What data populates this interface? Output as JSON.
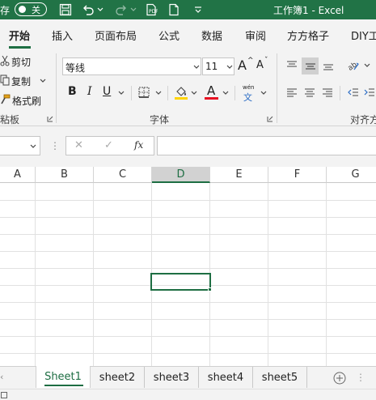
{
  "titlebar": {
    "autosave_label": "存",
    "toggle_label": "关",
    "title": "工作簿1 - Excel"
  },
  "tabs": [
    "开始",
    "插入",
    "页面布局",
    "公式",
    "数据",
    "审阅",
    "方方格子",
    "DIY工"
  ],
  "ribbon": {
    "clipboard": {
      "cut": "剪切",
      "copy": "复制",
      "format_painter": "格式刷",
      "group_label": "粘板"
    },
    "font": {
      "font_name": "等线",
      "font_size": "11",
      "grow_label": "A",
      "shrink_label": "A",
      "bold": "B",
      "italic": "I",
      "underline": "U",
      "font_color_label": "A",
      "phonetic_top": "wén",
      "phonetic_bottom": "文",
      "group_label": "字体"
    },
    "alignment": {
      "group_label": "对齐方"
    }
  },
  "formula": {
    "cancel": "✕",
    "enter": "✓",
    "fx": "fx"
  },
  "grid": {
    "columns": [
      "A",
      "B",
      "C",
      "D",
      "E",
      "F",
      "G"
    ],
    "selected_column": "D"
  },
  "sheets": [
    "Sheet1",
    "sheet2",
    "sheet3",
    "sheet4",
    "sheet5"
  ],
  "active_sheet": "Sheet1",
  "colors": {
    "title_green": "#217346",
    "accent_green": "#1e6e43",
    "highlight_yellow": "#ffd400",
    "font_red": "#e81123"
  }
}
